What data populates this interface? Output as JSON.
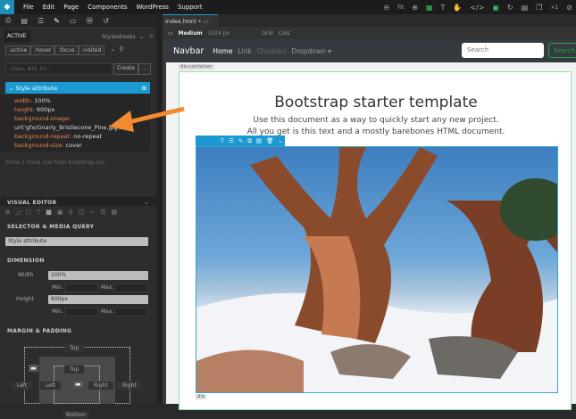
{
  "menubar": {
    "items": [
      "File",
      "Edit",
      "Page",
      "Components",
      "WordPress",
      "Support"
    ],
    "zoom_fit": "Fit",
    "multiplier": "×1"
  },
  "left": {
    "active_tab": "ACTIVE",
    "stylesheets_label": "Stylesheets",
    "pseudo": [
      ":active",
      ":hover",
      ":focus",
      ":visited"
    ],
    "selector_placeholder": ".class, #id, h1...",
    "create": "Create",
    "more": "...",
    "style_attr_header": "Style attribute",
    "props": [
      {
        "k": "width:",
        "v": "100%"
      },
      {
        "k": "height:",
        "v": "600px"
      },
      {
        "k": "background-image:",
        "v": ""
      },
      {
        "k": "",
        "v": "url('gfx/Gnarly_Bristlecone_Pine.jpg')"
      },
      {
        "k": "background-repeat:",
        "v": "no-repeat"
      },
      {
        "k": "background-size:",
        "v": "cover"
      }
    ],
    "more_rules": "Show 1 more rule from bootstrap.css",
    "visual_editor": "VISUAL EDITOR",
    "selector_media": "SELECTOR & MEDIA QUERY",
    "selector_value": "Style attribute",
    "dimension": "DIMENSION",
    "width_label": "Width",
    "width_value": "100%",
    "height_label": "Height",
    "height_value": "600px",
    "min": "Min.",
    "max": "Max.",
    "margin_padding": "MARGIN & PADDING",
    "top": "Top",
    "left": "Left",
    "right": "Right",
    "bottom": "Bottom"
  },
  "canvas": {
    "tab": "index.html •",
    "device": "Medium",
    "width": "1024 px",
    "grid": "Grid",
    "cols": "Cols"
  },
  "page": {
    "brand": "Navbar",
    "links": [
      "Home",
      "Link",
      "Disabled",
      "Dropdown ▾"
    ],
    "search_placeholder": "Search",
    "search_button": "Search",
    "container_tag": "div.container",
    "title": "Bootstrap starter template",
    "lead1": "Use this document as a way to quickly start any new project.",
    "lead2": "All you get is this text and a mostly barebones HTML document.",
    "div_tag": "div"
  },
  "colors": {
    "accent": "#1a9ad0",
    "arrow": "#f28a2e",
    "property": "#e8874a",
    "success": "#28a745"
  }
}
